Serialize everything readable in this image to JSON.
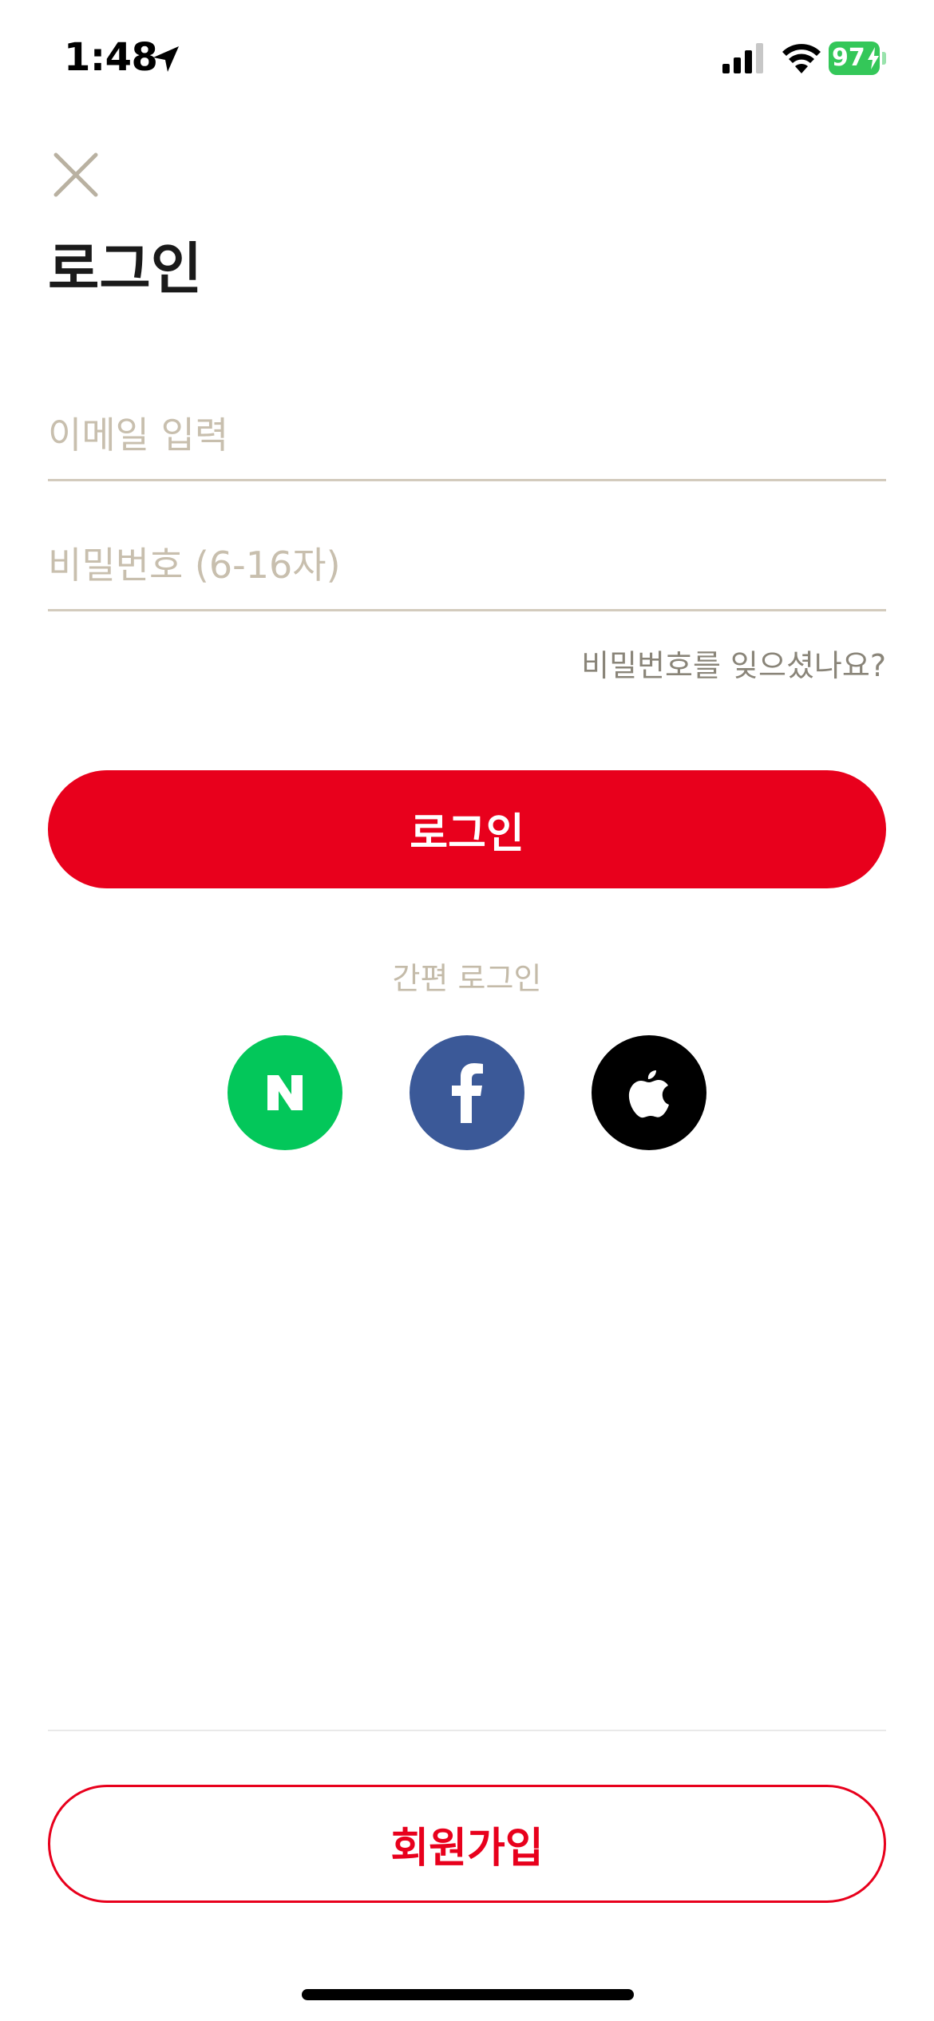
{
  "status_bar": {
    "time": "1:48",
    "battery_level": "97",
    "icons": [
      "location-arrow-icon",
      "cellular-signal-icon",
      "wifi-icon",
      "battery-icon",
      "charging-bolt-icon"
    ]
  },
  "header": {
    "close_icon": "close-icon",
    "title": "로그인"
  },
  "form": {
    "email_placeholder": "이메일 입력",
    "email_value": "",
    "password_placeholder": "비밀번호 (6-16자)",
    "password_value": "",
    "forgot_password": "비밀번호를 잊으셨나요?",
    "login_button": "로그인"
  },
  "social_login": {
    "label": "간편 로그인",
    "providers": [
      {
        "name": "naver",
        "icon": "naver-n-icon",
        "color": "#03c75a"
      },
      {
        "name": "facebook",
        "icon": "facebook-f-icon",
        "color": "#3b5998"
      },
      {
        "name": "apple",
        "icon": "apple-logo-icon",
        "color": "#000000"
      }
    ]
  },
  "footer": {
    "signup_button": "회원가입"
  },
  "colors": {
    "accent": "#e8001c",
    "placeholder": "#c8bfae",
    "underline": "#d3cbbd"
  }
}
